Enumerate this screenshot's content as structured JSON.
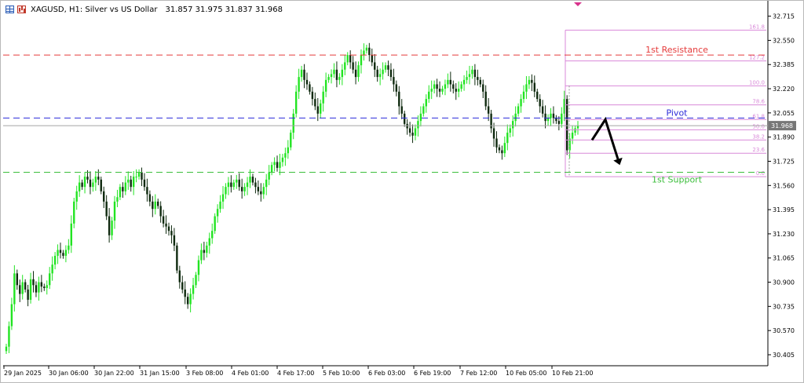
{
  "header": {
    "table_icon": "table-icon",
    "chart_icon": "chart-icon",
    "symbol_text": "XAGUSD, H1:  Silver vs US Dollar",
    "ohlc_text": "31.857 31.975 31.837 31.968"
  },
  "colors": {
    "bull": "#22e422",
    "bear": "#0f2a0f",
    "resistance": "#e53b3b",
    "pivot": "#2b2bd9",
    "support": "#3cbe3c",
    "fib": "#d98ad9",
    "price_line": "#a5a5a5",
    "price_tag_bg": "#777777"
  },
  "chart_data": {
    "type": "candlestick",
    "symbol": "XAGUSD",
    "timeframe": "H1",
    "description": "Silver vs US Dollar",
    "ylim": [
      30.33,
      32.82
    ],
    "yticks": [
      "32.715",
      "32.550",
      "32.385",
      "32.220",
      "32.055",
      "31.890",
      "31.725",
      "31.560",
      "31.395",
      "31.230",
      "31.065",
      "30.900",
      "30.735",
      "30.570",
      "30.405"
    ],
    "xticks": [
      "29 Jan 2025",
      "30 Jan 06:00",
      "30 Jan 22:00",
      "31 Jan 15:00",
      "3 Feb 08:00",
      "4 Feb 01:00",
      "4 Feb 17:00",
      "5 Feb 10:00",
      "6 Feb 03:00",
      "6 Feb 19:00",
      "7 Feb 12:00",
      "10 Feb 05:00",
      "10 Feb 21:00"
    ],
    "current_price": "31.968",
    "closes": [
      30.46,
      30.6,
      30.75,
      30.96,
      30.88,
      30.82,
      30.9,
      30.85,
      30.78,
      30.92,
      30.88,
      30.83,
      30.9,
      30.87,
      30.86,
      30.88,
      30.96,
      31.02,
      31.08,
      31.12,
      31.1,
      31.08,
      31.12,
      31.15,
      31.3,
      31.45,
      31.52,
      31.58,
      31.55,
      31.62,
      31.6,
      31.55,
      31.58,
      31.62,
      31.6,
      31.52,
      31.45,
      31.35,
      31.22,
      31.32,
      31.45,
      31.48,
      31.55,
      31.52,
      31.58,
      31.6,
      31.55,
      31.62,
      31.62,
      31.65,
      31.6,
      31.55,
      31.5,
      31.45,
      31.4,
      31.45,
      31.42,
      31.35,
      31.3,
      31.28,
      31.25,
      31.22,
      31.15,
      30.98,
      30.9,
      30.85,
      30.8,
      30.75,
      30.82,
      30.88,
      30.95,
      31.05,
      31.12,
      31.1,
      31.15,
      31.2,
      31.25,
      31.35,
      31.4,
      31.45,
      31.5,
      31.55,
      31.58,
      31.55,
      31.58,
      31.6,
      31.55,
      31.52,
      31.55,
      31.58,
      31.62,
      31.58,
      31.55,
      31.52,
      31.5,
      31.55,
      31.6,
      31.65,
      31.7,
      31.72,
      31.68,
      31.72,
      31.75,
      31.78,
      31.82,
      31.92,
      32.05,
      32.2,
      32.3,
      32.35,
      32.28,
      32.25,
      32.2,
      32.15,
      32.1,
      32.05,
      32.12,
      32.2,
      32.28,
      32.3,
      32.32,
      32.35,
      32.28,
      32.3,
      32.35,
      32.4,
      32.45,
      32.4,
      32.35,
      32.3,
      32.38,
      32.45,
      32.48,
      32.5,
      32.45,
      32.4,
      32.35,
      32.3,
      32.32,
      32.35,
      32.38,
      32.35,
      32.3,
      32.25,
      32.2,
      32.1,
      32.05,
      31.98,
      31.95,
      31.92,
      31.9,
      31.95,
      32.0,
      32.05,
      32.1,
      32.15,
      32.2,
      32.22,
      32.25,
      32.22,
      32.2,
      32.22,
      32.25,
      32.28,
      32.25,
      32.22,
      32.2,
      32.22,
      32.25,
      32.28,
      32.3,
      32.32,
      32.35,
      32.3,
      32.28,
      32.25,
      32.2,
      32.1,
      32.05,
      31.95,
      31.88,
      31.82,
      31.8,
      31.78,
      31.85,
      31.92,
      31.95,
      32.0,
      32.05,
      32.1,
      32.15,
      32.2,
      32.25,
      32.28,
      32.26,
      32.2,
      32.15,
      32.1,
      32.05,
      32.0,
      32.02,
      32.05,
      32.02,
      32.0,
      31.98,
      32.05,
      32.15,
      31.8,
      31.88,
      31.92,
      31.95,
      31.968
    ],
    "levels": [
      {
        "label": "1st Resistance",
        "value": 32.45,
        "style": "dashed",
        "color": "resistance"
      },
      {
        "label": "Pivot",
        "value": 32.02,
        "style": "dashed",
        "color": "pivot"
      },
      {
        "label": "1st Support",
        "value": 31.65,
        "style": "dashed",
        "color": "support"
      }
    ],
    "fibonacci": [
      {
        "label": "161.8",
        "value": 32.62
      },
      {
        "label": "127.2",
        "value": 32.41
      },
      {
        "label": "100.0",
        "value": 32.24
      },
      {
        "label": "78.6",
        "value": 32.11
      },
      {
        "label": "61.8",
        "value": 32.01
      },
      {
        "label": "50.0",
        "value": 31.94
      },
      {
        "label": "38.2",
        "value": 31.87
      },
      {
        "label": "23.6",
        "value": 31.78
      },
      {
        "label": "0.0",
        "value": 31.62
      }
    ],
    "projection": [
      31.87,
      32.01,
      31.74
    ]
  }
}
